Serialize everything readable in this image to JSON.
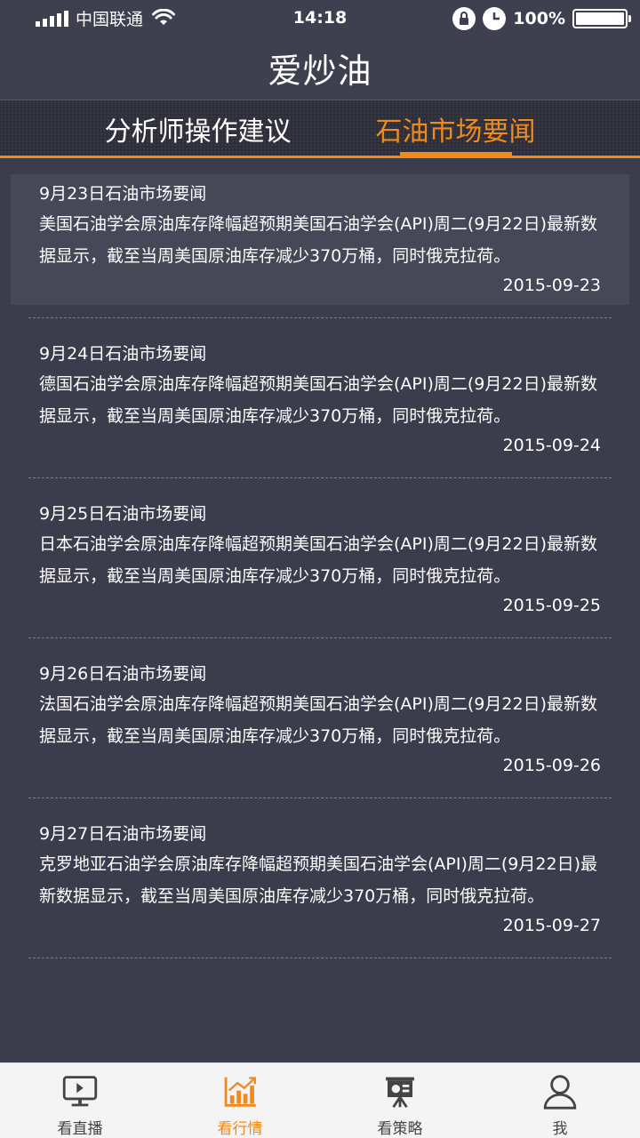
{
  "status_bar": {
    "carrier": "中国联通",
    "time": "14:18",
    "battery": "100%"
  },
  "header": {
    "title": "爱炒油"
  },
  "tabs": [
    {
      "label": "分析师操作建议",
      "active": false
    },
    {
      "label": "石油市场要闻",
      "active": true
    }
  ],
  "news": [
    {
      "title": "9月23日石油市场要闻",
      "body": "美国石油学会原油库存降幅超预期美国石油学会(API)周二(9月22日)最新数据显示，截至当周美国原油库存减少370万桶，同时俄克拉荷。",
      "date": "2015-09-23"
    },
    {
      "title": "9月24日石油市场要闻",
      "body": "德国石油学会原油库存降幅超预期美国石油学会(API)周二(9月22日)最新数据显示，截至当周美国原油库存减少370万桶，同时俄克拉荷。",
      "date": "2015-09-24"
    },
    {
      "title": "9月25日石油市场要闻",
      "body": "日本石油学会原油库存降幅超预期美国石油学会(API)周二(9月22日)最新数据显示，截至当周美国原油库存减少370万桶，同时俄克拉荷。",
      "date": "2015-09-25"
    },
    {
      "title": "9月26日石油市场要闻",
      "body": "法国石油学会原油库存降幅超预期美国石油学会(API)周二(9月22日)最新数据显示，截至当周美国原油库存减少370万桶，同时俄克拉荷。",
      "date": "2015-09-26"
    },
    {
      "title": "9月27日石油市场要闻",
      "body": "克罗地亚石油学会原油库存降幅超预期美国石油学会(API)周二(9月22日)最新数据显示，截至当周美国原油库存减少370万桶，同时俄克拉荷。",
      "date": "2015-09-27"
    }
  ],
  "bottom_nav": [
    {
      "label": "看直播",
      "icon": "monitor-icon",
      "active": false
    },
    {
      "label": "看行情",
      "icon": "chart-icon",
      "active": true
    },
    {
      "label": "看策略",
      "icon": "presentation-icon",
      "active": false
    },
    {
      "label": "我",
      "icon": "user-icon",
      "active": false
    }
  ],
  "colors": {
    "accent": "#f08a1c",
    "background": "#3b3c4c",
    "header": "#3e3f4f",
    "nav_background": "#f4f4f4"
  }
}
